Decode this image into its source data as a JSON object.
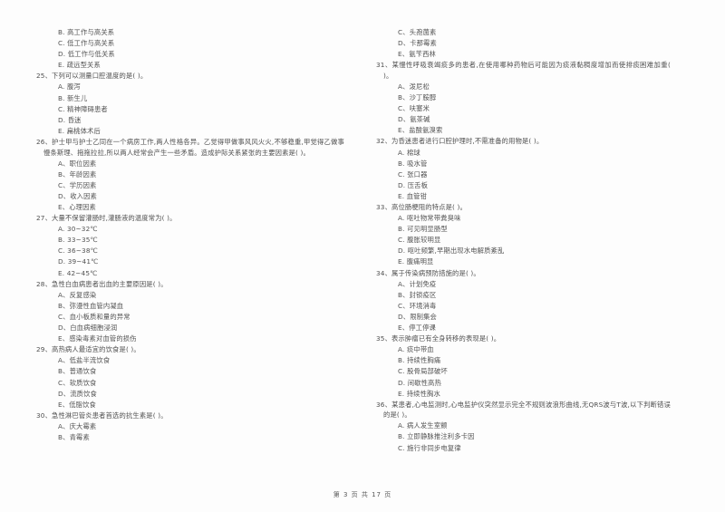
{
  "document": {
    "type": "exam-paper",
    "language": "zh-CN",
    "footer": "第 3 页 共 17 页"
  },
  "left_column": {
    "carryover_options": [
      "B. 高工作与高关系",
      "C. 低工作与高关系",
      "D. 低工作与低关系",
      "E. 疏远型关系"
    ],
    "questions": [
      {
        "number": "25",
        "stem": "25、下列可以测量口腔温度的是(        )。",
        "options": [
          "A. 腹泻",
          "B. 新生儿",
          "C. 精神障碍患者",
          "D. 昏迷",
          "E. 扁桃体术后"
        ]
      },
      {
        "number": "26",
        "stem": "26、护士甲与护士乙同在一个病房工作,两人性格各异。乙觉得甲做事风风火火,不够稳重,甲觉得乙做事慢条斯理、拖拖拉拉,所以两人经常会产生一些矛盾。造成护际关系紧张的主要因素是(        )。",
        "options": [
          "A、职位因素",
          "B、年龄因素",
          "C、学历因素",
          "D、收入因素",
          "E、心理因素"
        ]
      },
      {
        "number": "27",
        "stem": "27、大量不保留灌肠时,灌肠液的温度常为(        )。",
        "options": [
          "A. 30~32℃",
          "B. 33~35℃",
          "C. 36~38℃",
          "D. 39~41℃",
          "E. 42~45℃"
        ]
      },
      {
        "number": "28",
        "stem": "28、急性白血病患者出血的主要原因是(        )。",
        "options": [
          "A、反复感染",
          "B、弥漫性血管内凝血",
          "C、血小板质和量的异常",
          "D、白血病细胞浸润",
          "E、感染毒素对血管的损伤"
        ]
      },
      {
        "number": "29",
        "stem": "29、高热病人最适宜的饮食是(        )。",
        "options": [
          "A、低盐半流饮食",
          "B、普通饮食",
          "C、软质饮食",
          "D、流质饮食",
          "E、低脂饮食"
        ]
      },
      {
        "number": "30",
        "stem": "30、急性淋巴管炎患者首选的抗生素是(        )。",
        "options": [
          "A、庆大霉素",
          "B、青霉素"
        ]
      }
    ]
  },
  "right_column": {
    "carryover_options": [
      "C、头孢菌素",
      "D、卡那霉素",
      "E、氨苄西林"
    ],
    "questions": [
      {
        "number": "31",
        "stem": "31、某慢性呼吸衰竭痰多的患者,在使用哪种药物后可能因为痰液黏稠度增加而使排痰困难加重(        )。",
        "options": [
          "A、泼尼松",
          "B、沙丁胺醇",
          "C、呋塞米",
          "D、氨茶碱",
          "E、盐酸氨溴索"
        ]
      },
      {
        "number": "32",
        "stem": "32、为昏迷患者进行口腔护理时,不需准备的用物是(        )。",
        "options": [
          "A. 棉球",
          "B. 吸水管",
          "C. 张口器",
          "D. 压舌板",
          "E. 血管钳"
        ]
      },
      {
        "number": "33",
        "stem": "33、高位肠梗阻的特点是(        )。",
        "options": [
          "A. 呕吐物常带粪臭味",
          "B. 可见明显肠型",
          "C. 腹胀较明显",
          "D. 呕吐频繁,早期出现水电解质紊乱",
          "E. 腹痛明显"
        ]
      },
      {
        "number": "34",
        "stem": "34、属于传染病预防措施的是(        )。",
        "options": [
          "A、计划免疫",
          "B、封锁疫区",
          "C、环境消毒",
          "D、限制集会",
          "E、停工停课"
        ]
      },
      {
        "number": "35",
        "stem": "35、表示肿瘤已有全身转移的表现是(        )。",
        "options": [
          "A. 痰中带血",
          "B. 持续性胸痛",
          "C. 股骨局部破坏",
          "D. 间歇性高热",
          "E. 持续性胸水"
        ]
      },
      {
        "number": "36",
        "stem": "36、某患者,心电监测时,心电监护仪突然显示完全不规则波浪形曲线,无QRS波与T波,以下判断错误的是(        )。",
        "options": [
          "A. 病人发生室颤",
          "B. 立即静脉推注利多卡因",
          "C. 施行非同步电复律"
        ]
      }
    ]
  }
}
